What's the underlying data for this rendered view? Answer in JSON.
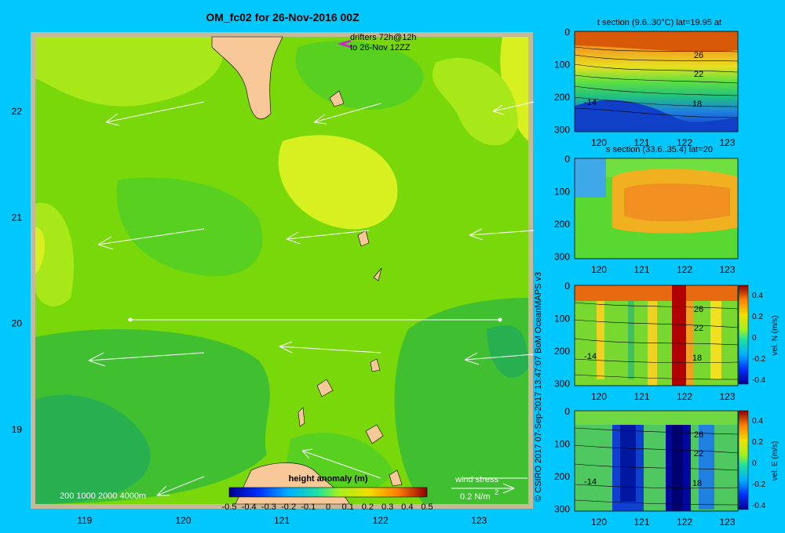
{
  "map": {
    "title": "OM_fc02 for 26-Nov-2016 00Z",
    "drifters_line1": "drifters 72h@12h",
    "drifters_line2": "to 26-Nov 12ZZ",
    "depth_legend": "200  1000  2000  4000m",
    "colorbar_title": "height anomaly (m)",
    "colorbar_ticks": [
      "-0.5",
      "-0.4",
      "-0.3",
      "-0.2",
      "-0.1",
      "0",
      "0.1",
      "0.2",
      "0.3",
      "0.4",
      "0.5"
    ],
    "wind_label": "wind stress",
    "wind_scale": "0.2 N/m",
    "wind_scale_sup": "2",
    "credit": "© CSIRO 2017   07-Sep-2017 13:47:07 BoM OceanMAPS v3"
  },
  "chart_data": [
    {
      "type": "heatmap",
      "title": "OM_fc02 for 26-Nov-2016 00Z",
      "xlim": [
        118.5,
        123.5
      ],
      "ylim": [
        18.3,
        22.7
      ],
      "xticks": [
        "119",
        "120",
        "121",
        "122",
        "123"
      ],
      "yticks": [
        "19",
        "20",
        "21",
        "22"
      ],
      "colorbar": {
        "label": "height anomaly (m)",
        "range": [
          -0.5,
          0.5
        ]
      },
      "section_line": {
        "lat": 20,
        "lon_start": 119.5,
        "lon_end": 122.8
      }
    },
    {
      "type": "heatmap",
      "title": "t section (9.6..30°C) lat=19.95 at",
      "xticks": [
        "120",
        "121",
        "122",
        "123"
      ],
      "yticks": [
        "0",
        "100",
        "200",
        "300"
      ],
      "contour_labels": [
        "26",
        "22",
        "18",
        "-14"
      ]
    },
    {
      "type": "heatmap",
      "title": "s section (33.6..35.4) lat=20",
      "xticks": [
        "120",
        "121",
        "122",
        "123"
      ],
      "yticks": [
        "0",
        "100",
        "200",
        "300"
      ]
    },
    {
      "type": "heatmap",
      "title": "",
      "xticks": [
        "120",
        "121",
        "122",
        "123"
      ],
      "yticks": [
        "0",
        "100",
        "200",
        "300"
      ],
      "contour_labels": [
        "26",
        "22",
        "18",
        "-14"
      ],
      "colorbar": {
        "label": "vel. N  (m/s)",
        "range": [
          -0.4,
          0.4
        ],
        "ticks": [
          "0.4",
          "0.2",
          "0",
          "-0.2",
          "-0.4"
        ]
      }
    },
    {
      "type": "heatmap",
      "title": "",
      "xticks": [
        "120",
        "121",
        "122",
        "123"
      ],
      "yticks": [
        "0",
        "100",
        "200",
        "300"
      ],
      "contour_labels": [
        "26",
        "22",
        "18",
        "-14"
      ],
      "colorbar": {
        "label": "vel. E  (m/s)",
        "range": [
          -0.4,
          0.4
        ],
        "ticks": [
          "0.4",
          "0.2",
          "0",
          "-0.2",
          "-0.4"
        ]
      }
    }
  ]
}
